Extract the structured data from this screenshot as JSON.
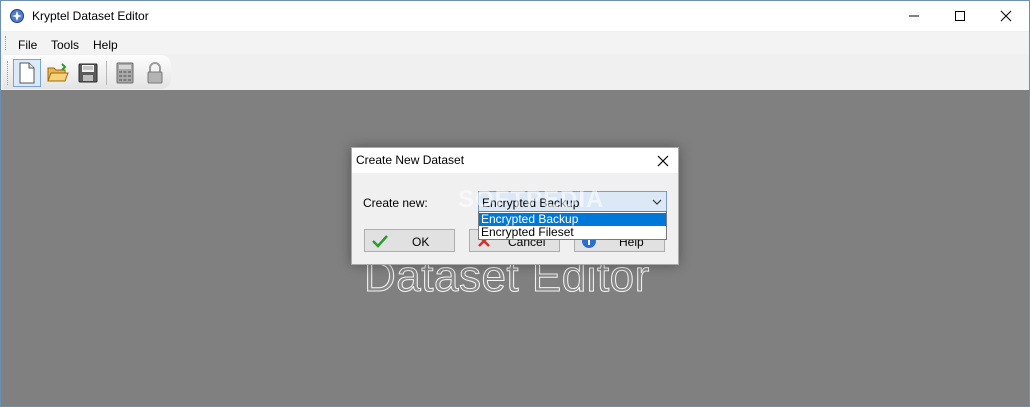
{
  "window": {
    "title": "Kryptel Dataset Editor"
  },
  "menu": {
    "items": [
      "File",
      "Tools",
      "Help"
    ]
  },
  "toolbar": {
    "buttons": [
      "new-document",
      "open-folder",
      "save-disk",
      "calculator",
      "lock"
    ]
  },
  "background": {
    "text": "Dataset Editor"
  },
  "watermark": {
    "text": "SOFTPEDIA"
  },
  "dialog": {
    "title": "Create New Dataset",
    "create_label": "Create new:",
    "combo_value": "Encrypted Backup",
    "options": [
      "Encrypted Backup",
      "Encrypted Fileset"
    ],
    "selected_index": 0,
    "ok_label": "OK",
    "cancel_label": "Cancel",
    "help_label": "Help"
  },
  "colors": {
    "accent": "#0078d7",
    "workspace": "#808080",
    "dialog_bg": "#f0f0f0"
  }
}
